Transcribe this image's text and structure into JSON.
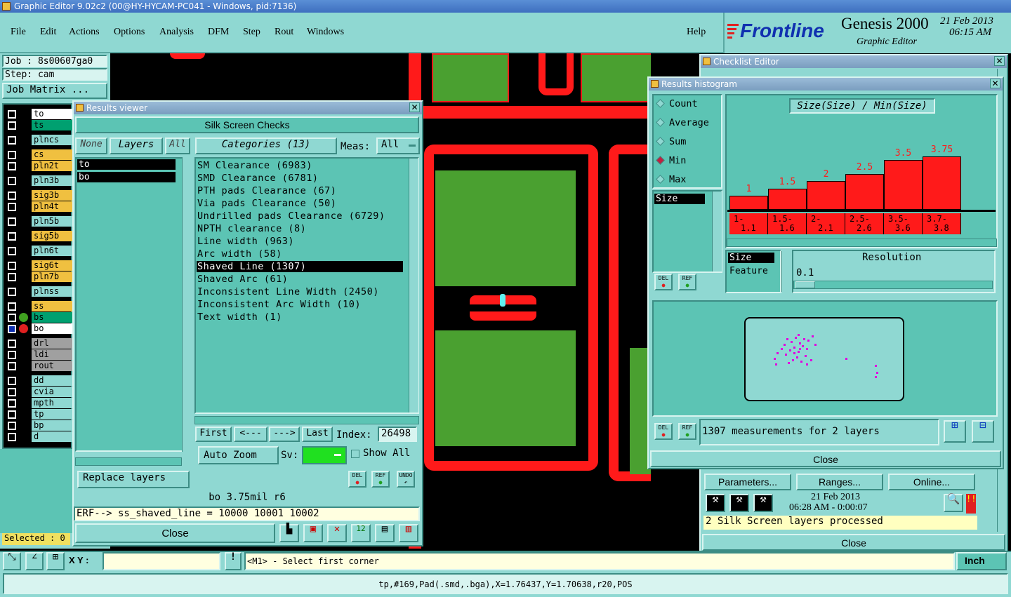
{
  "window_title": "Graphic Editor 9.02c2 (00@HY-HYCAM-PC041 - Windows, pid:7136)",
  "menu": {
    "file": "File",
    "edit": "Edit",
    "actions": "Actions",
    "options": "Options",
    "analysis": "Analysis",
    "dfm": "DFM",
    "step": "Step",
    "rout": "Rout",
    "windows": "Windows",
    "help": "Help"
  },
  "logo": {
    "brand": "Frontline",
    "product": "Genesis 2000",
    "subtitle": "Graphic Editor",
    "date": "21 Feb 2013",
    "time": "06:15 AM"
  },
  "job": {
    "job": "Job : 8s00607ga0",
    "step": "Step: cam",
    "matrix": "Job Matrix ...",
    "selected": "Selected : 0"
  },
  "layers": [
    {
      "name": "to",
      "color": "#ffffff"
    },
    {
      "name": "ts",
      "color": "#00a070"
    },
    {
      "name": "plncs",
      "color": "#8fd8d2"
    },
    {
      "name": "cs",
      "color": "#f0c040"
    },
    {
      "name": "pln2t",
      "color": "#f0c040"
    },
    {
      "name": "pln3b",
      "color": "#8fd8d2"
    },
    {
      "name": "sig3b",
      "color": "#f0c040"
    },
    {
      "name": "pln4t",
      "color": "#f0c040"
    },
    {
      "name": "pln5b",
      "color": "#8fd8d2"
    },
    {
      "name": "sig5b",
      "color": "#f0c040"
    },
    {
      "name": "pln6t",
      "color": "#8fd8d2"
    },
    {
      "name": "sig6t",
      "color": "#f0c040"
    },
    {
      "name": "pln7b",
      "color": "#f0c040"
    },
    {
      "name": "plnss",
      "color": "#8fd8d2"
    },
    {
      "name": "ss",
      "color": "#f0c040"
    },
    {
      "name": "bs",
      "color": "#00a070"
    },
    {
      "name": "bo",
      "color": "#ffffff"
    },
    {
      "name": "drl",
      "color": "#a0a0a0"
    },
    {
      "name": "ldi",
      "color": "#a0a0a0"
    },
    {
      "name": "rout",
      "color": "#a0a0a0"
    },
    {
      "name": "dd",
      "color": "#8fd8d2"
    },
    {
      "name": "cvia",
      "color": "#8fd8d2"
    },
    {
      "name": "mpth",
      "color": "#8fd8d2"
    },
    {
      "name": "tp",
      "color": "#8fd8d2"
    },
    {
      "name": "bp",
      "color": "#8fd8d2"
    },
    {
      "name": "d",
      "color": "#8fd8d2"
    }
  ],
  "results_viewer": {
    "title": "Results viewer",
    "header": "Silk Screen Checks",
    "none": "None",
    "layers_btn": "Layers",
    "all": "All",
    "categories_btn": "Categories (13)",
    "meas_label": "Meas:",
    "meas_value": "All",
    "layer_list": [
      "to",
      "bo"
    ],
    "categories": [
      "SM Clearance (6983)",
      "SMD Clearance (6781)",
      "PTH pads Clearance (67)",
      "Via pads Clearance (50)",
      "Undrilled pads Clearance (6729)",
      "NPTH clearance (8)",
      "Line width (963)",
      "Arc width (58)",
      "Shaved Line (1307)",
      "Shaved Arc (61)",
      "Inconsistent Line Width (2450)",
      "Inconsistent Arc Width (10)",
      "Text width (1)"
    ],
    "selected_category": "Shaved Line (1307)",
    "first": "First",
    "prev": "<---",
    "next": "--->",
    "last": "Last",
    "index_label": "Index:",
    "index_value": "26498",
    "auto_zoom": "Auto Zoom",
    "sv": "Sv:",
    "show_all": "Show All",
    "replace_layers": "Replace layers",
    "status": "bo 3.75mil  r6",
    "erf": "ERF--> ss_shaved_line = 10000 10001 10002",
    "close": "Close",
    "del": "DEL",
    "ref": "REF",
    "undo": "UNDO"
  },
  "histogram": {
    "title": "Results histogram",
    "chart_title": "Size(Size) / Min(Size)",
    "modes": [
      "Count",
      "Average",
      "Sum",
      "Min",
      "Max"
    ],
    "selected_mode": "Min",
    "list_item": "Size",
    "size_label": "Size",
    "feature_label": "Feature",
    "resolution_label": "Resolution",
    "resolution_value": "0.1",
    "summary": "1307 measurements for 2 layers",
    "close": "Close",
    "del": "DEL",
    "ref": "REF"
  },
  "chart_data": {
    "type": "bar",
    "title": "Size(Size) / Min(Size)",
    "categories": [
      "1-\n1.1",
      "1.5-\n1.6",
      "2-\n2.1",
      "2.5-\n2.6",
      "3.5-\n3.6",
      "3.7-\n3.8"
    ],
    "category_labels": [
      [
        "1-",
        "1.1"
      ],
      [
        "1.5-",
        "1.6"
      ],
      [
        "2-",
        "2.1"
      ],
      [
        "2.5-",
        "2.6"
      ],
      [
        "3.5-",
        "3.6"
      ],
      [
        "3.7-",
        "3.8"
      ]
    ],
    "values": [
      1,
      1.5,
      2,
      2.5,
      3.5,
      3.75
    ],
    "value_labels": [
      "1",
      "1.5",
      "2",
      "2.5",
      "3.5",
      "3.75"
    ],
    "ylim": [
      0,
      3.75
    ]
  },
  "checklist": {
    "title": "Checklist Editor",
    "parameters": "Parameters...",
    "ranges": "Ranges...",
    "online": "Online...",
    "date": "21 Feb 2013",
    "time": "06:28 AM - 0:00:07",
    "status": "2 Silk Screen layers processed",
    "close": "Close"
  },
  "bottom": {
    "xy_label": "X Y :",
    "prompt": "<M1> - Select first corner",
    "units": "Inch",
    "status_line": "tp,#169,Pad(.smd,.bga),X=1.76437,Y=1.70638,r20,POS"
  }
}
